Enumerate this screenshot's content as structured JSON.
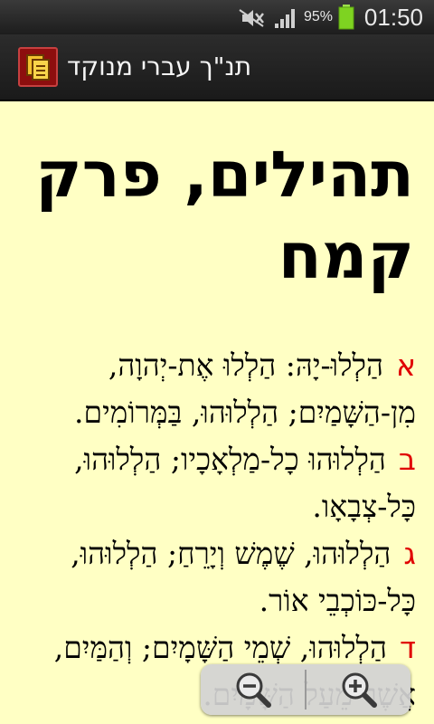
{
  "status_bar": {
    "battery_percent": "95%",
    "time": "01:50",
    "icons": [
      "mute-icon",
      "signal-icon",
      "battery-icon"
    ]
  },
  "app_bar": {
    "title": "תנ\"ך עברי מנוקד",
    "icon": "book-pages-icon"
  },
  "chapter": {
    "title": "תהילים, פרק קמח"
  },
  "verses": [
    {
      "num": "א",
      "text": "הַלְלוּ-יָהּ: הַלְלוּ אֶת-יְהוָה, מִן-הַשָּׁמַיִם; הַלְלוּהוּ, בַּמְּרוֹמִים."
    },
    {
      "num": "ב",
      "text": "הַלְלוּהוּ כָל-מַלְאָכָיו; הַלְלוּהוּ, כָּל-צְבָאָו."
    },
    {
      "num": "ג",
      "text": "הַלְלוּהוּ, שֶׁמֶשׁ וְיָרֵחַ; הַלְלוּהוּ, כָּל-כּוֹכְבֵי אוֹר."
    },
    {
      "num": "ד",
      "text": "הַלְלוּהוּ, שְׁמֵי הַשָּׁמָיִם; וְהַמַּיִם, אֲשֶׁר מֵעַל הַשָּׁמָיִם."
    }
  ],
  "zoom": {
    "zoom_out_icon": "zoom-out-icon",
    "zoom_in_icon": "zoom-in-icon"
  },
  "colors": {
    "content_background": "#ffffc4",
    "verse_number": "#e00000"
  }
}
